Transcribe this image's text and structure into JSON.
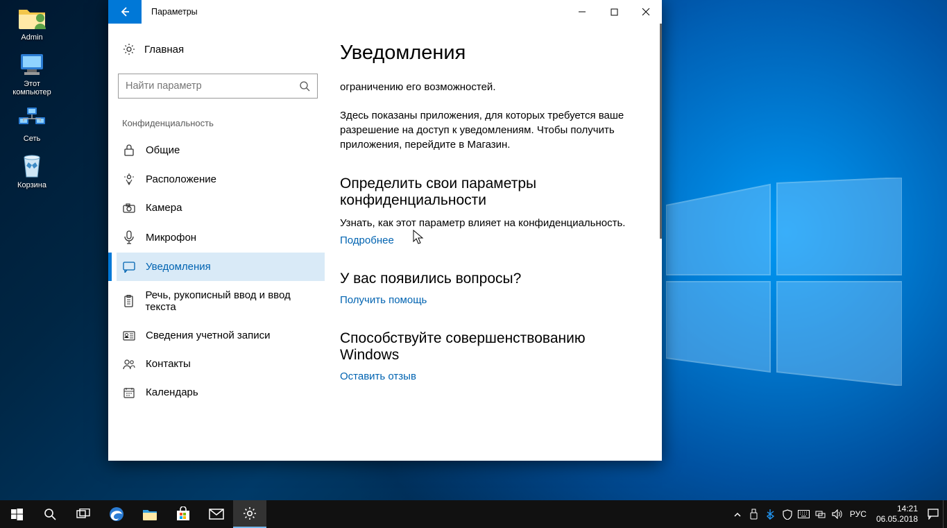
{
  "desktop": {
    "icons": [
      {
        "label": "Admin"
      },
      {
        "label": "Этот компьютер"
      },
      {
        "label": "Сеть"
      },
      {
        "label": "Корзина"
      }
    ]
  },
  "window": {
    "title": "Параметры",
    "home": "Главная",
    "search_placeholder": "Найти параметр",
    "section": "Конфиденциальность",
    "items": [
      {
        "label": "Общие"
      },
      {
        "label": "Расположение"
      },
      {
        "label": "Камера"
      },
      {
        "label": "Микрофон"
      },
      {
        "label": "Уведомления"
      },
      {
        "label": "Речь, рукописный ввод и ввод текста"
      },
      {
        "label": "Сведения учетной записи"
      },
      {
        "label": "Контакты"
      },
      {
        "label": "Календарь"
      }
    ]
  },
  "content": {
    "heading": "Уведомления",
    "p1": "ограничению его возможностей.",
    "p2": "Здесь показаны приложения, для которых требуется ваше разрешение на доступ к уведомлениям. Чтобы получить приложения, перейдите в Магазин.",
    "h2a": "Определить свои параметры конфиденциальности",
    "sub_a": "Узнать, как этот параметр влияет на конфиденциальность.",
    "link_a": "Подробнее",
    "h2b": "У вас появились вопросы?",
    "link_b": "Получить помощь",
    "h2c": "Способствуйте совершенствованию Windows",
    "link_c": "Оставить отзыв"
  },
  "taskbar": {
    "lang": "РУС",
    "time": "14:21",
    "date": "06.05.2018"
  }
}
